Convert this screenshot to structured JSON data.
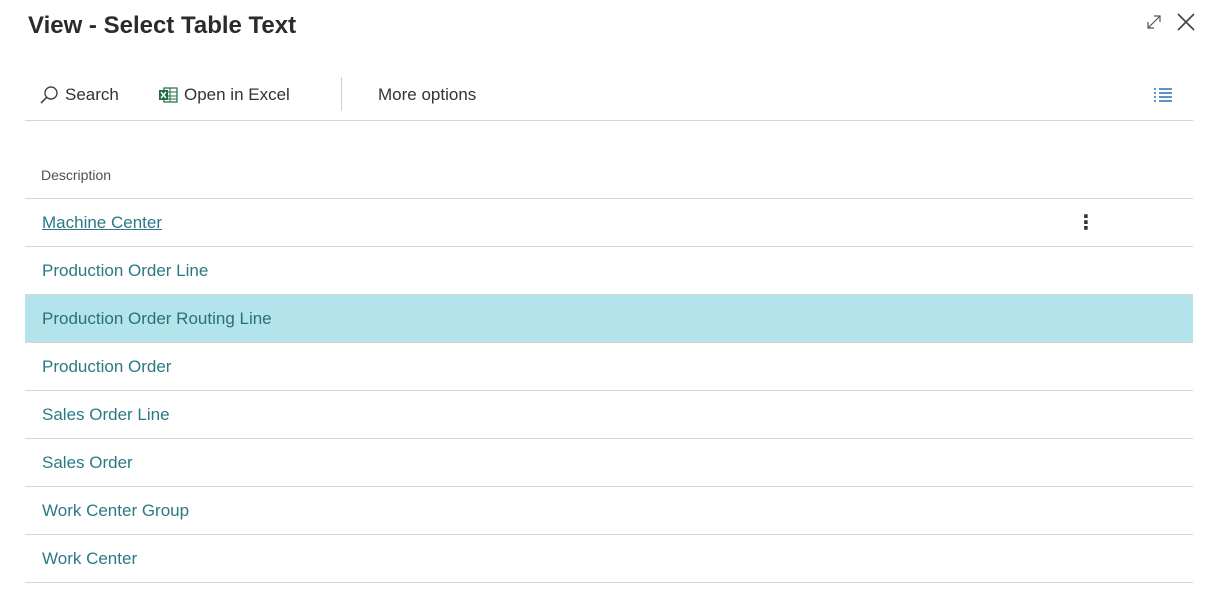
{
  "window": {
    "title": "View - Select Table Text",
    "expand_icon": "expand-icon",
    "close_icon": "close-icon"
  },
  "toolbar": {
    "search_label": "Search",
    "search_icon": "search-icon",
    "excel_label": "Open in Excel",
    "excel_icon": "excel-icon",
    "more_options_label": "More options",
    "list_view_icon": "list-view-icon"
  },
  "table": {
    "column_header": "Description",
    "rows": [
      {
        "description": "Machine Center",
        "state": "focused"
      },
      {
        "description": "Production Order Line"
      },
      {
        "description": "Production Order Routing Line",
        "state": "selected"
      },
      {
        "description": "Production Order"
      },
      {
        "description": "Sales Order Line"
      },
      {
        "description": "Sales Order"
      },
      {
        "description": "Work Center Group"
      },
      {
        "description": "Work Center"
      }
    ],
    "row_menu_glyph": "⋮"
  },
  "colors": {
    "link_text": "#2a7a85",
    "selected_row_bg": "#b4e4eb",
    "divider": "#d6d6d6"
  }
}
